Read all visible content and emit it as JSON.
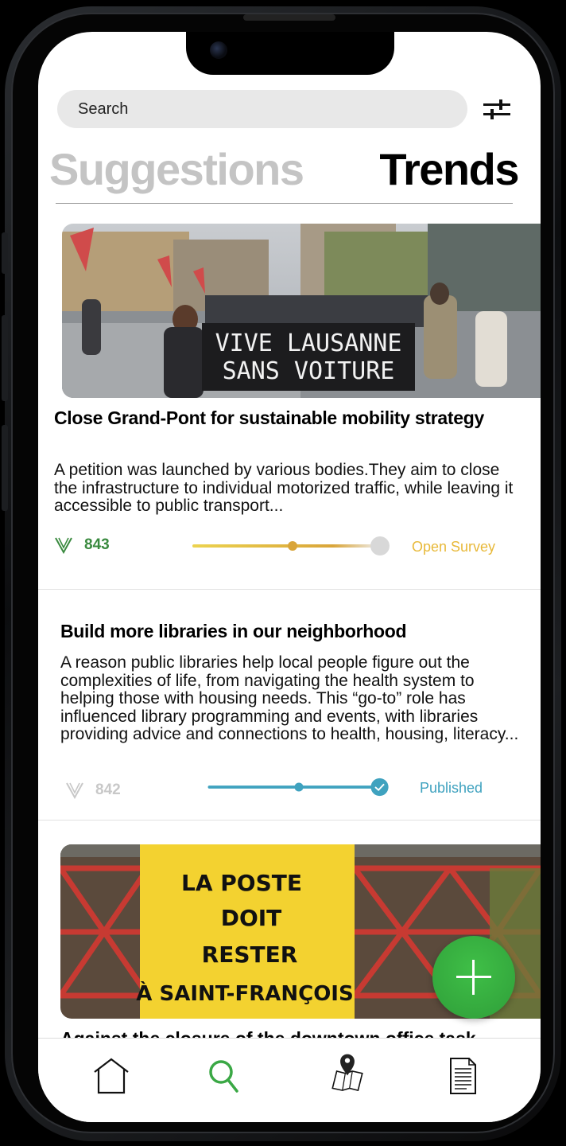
{
  "search": {
    "placeholder": "Search"
  },
  "tabs": {
    "suggestions": "Suggestions",
    "trends": "Trends",
    "active": "Trends"
  },
  "posts": [
    {
      "title": "Close Grand-Pont for sustainable mobility strategy",
      "description": "A petition was launched by various bodies.They aim to close the infrastructure to individual motorized traffic, while leaving it accessible to public transport...",
      "image_text": [
        "VIVE LAUSANNE",
        "SANS VOITURE"
      ],
      "votes": "843",
      "progress": 0.5,
      "status": "Open Survey",
      "accent": "#e8b93a",
      "votes_color": "#3a8a3f"
    },
    {
      "title": "Build more libraries in our neighborhood",
      "description": "A reason public libraries help local people figure out the complexities of life, from navigating the health system to helping those with housing needs. This “go-to” role has influenced library programming and events, with libraries providing advice and connections to health, housing, literacy...",
      "votes": "842",
      "progress": 1.0,
      "status": "Published",
      "accent": "#3fa2bf",
      "votes_color": "#c8c8c8"
    },
    {
      "title": "Against the closure of the downtown office task",
      "image_text": [
        "LA POSTE",
        "DOIT",
        "RESTER",
        "À SAINT-FRANÇOIS"
      ]
    }
  ],
  "nav": {
    "items": [
      "home-icon",
      "search-icon",
      "map-icon",
      "document-icon"
    ],
    "active": "search-icon"
  },
  "colors": {
    "green": "#3aa845",
    "yellow": "#e8b93a",
    "blue": "#3fa2bf"
  }
}
